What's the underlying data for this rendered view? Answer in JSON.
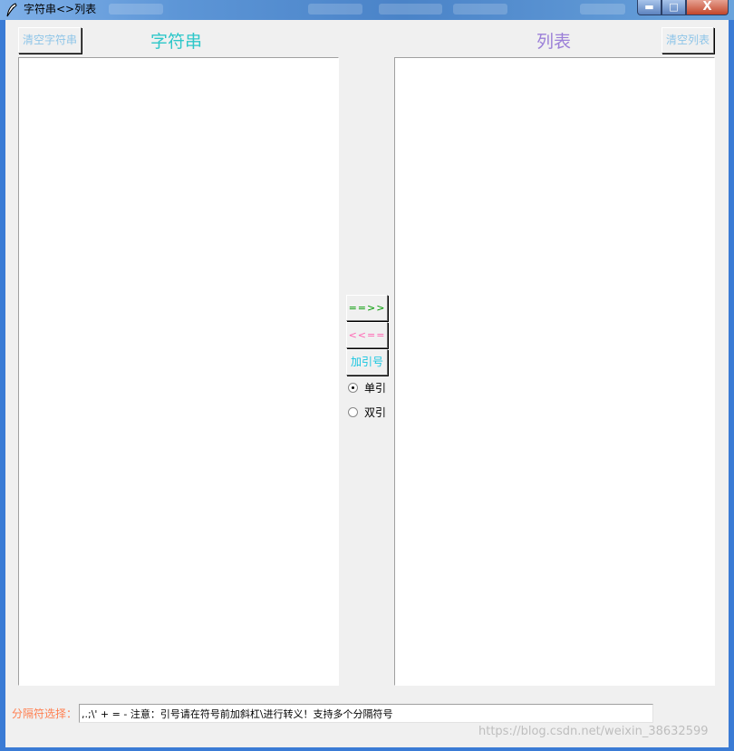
{
  "window": {
    "title": "字符串<>列表",
    "minimize_glyph": "▬",
    "maximize_glyph": "□",
    "close_glyph": "X",
    "icon": "feather-icon"
  },
  "toolbar": {
    "clear_string_label": "清空字符串",
    "clear_list_label": "清空列表",
    "string_heading": "字符串",
    "list_heading": "列表"
  },
  "string_textarea": {
    "value": ""
  },
  "list_textarea": {
    "value": ""
  },
  "middle": {
    "to_list_label": "==>>",
    "to_string_label": "<<==",
    "add_quotes_label": "加引号",
    "radios": [
      {
        "label": "单引",
        "checked": true
      },
      {
        "label": "双引",
        "checked": false
      }
    ]
  },
  "separator": {
    "label": "分隔符选择：",
    "value": ",.;\\' + = - 注意：引号请在符号前加斜杠\\进行转义！支持多个分隔符号"
  },
  "watermark": "https://blog.csdn.net/weixin_38632599",
  "colors": {
    "clear_button_text": "#8ec5e8",
    "string_heading": "#2ec7c9",
    "list_heading": "#9b7fd8",
    "to_list": "#009a00",
    "to_string": "#ff66b3",
    "add_quotes": "#19c6e0",
    "separator_label": "#ff7f50"
  }
}
